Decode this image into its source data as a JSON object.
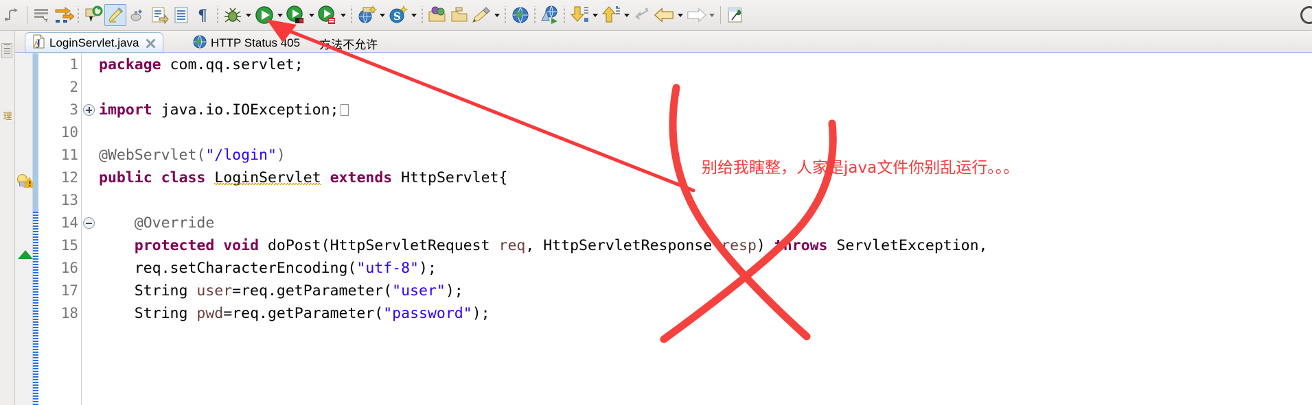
{
  "toolbar": {
    "items": [
      {
        "name": "skip-all-breakpoints-icon",
        "label": "Skip All Breakpoints"
      },
      {
        "name": "separator",
        "label": ""
      },
      {
        "name": "open-task-icon",
        "label": "Open Task"
      },
      {
        "name": "next-annotation-icon",
        "label": "Next Annotation"
      },
      {
        "name": "dots",
        "label": ""
      },
      {
        "name": "refresh-icon",
        "label": "Refresh"
      },
      {
        "name": "highlight-marker-icon",
        "label": "Toggle Mark Occurrences"
      },
      {
        "name": "build-icon",
        "label": "Build"
      },
      {
        "name": "new-java-file-icon",
        "label": "New Java File"
      },
      {
        "name": "open-type-icon",
        "label": "Open Type"
      },
      {
        "name": "pilcrow-icon",
        "label": "Show Whitespace Characters"
      },
      {
        "name": "dots",
        "label": ""
      },
      {
        "name": "debug-icon",
        "label": "Debug"
      },
      {
        "name": "debug-dropdown-arrow",
        "label": ""
      },
      {
        "name": "run-icon",
        "label": "Run"
      },
      {
        "name": "run-dropdown-arrow",
        "label": ""
      },
      {
        "name": "run-external-tools-icon",
        "label": "External Tools"
      },
      {
        "name": "external-tools-dropdown-arrow",
        "label": ""
      },
      {
        "name": "run-server-icon",
        "label": "Run On Server"
      },
      {
        "name": "server-dropdown-arrow",
        "label": ""
      },
      {
        "name": "dots",
        "label": ""
      },
      {
        "name": "new-web-project-icon",
        "label": "New Web Project"
      },
      {
        "name": "web-project-dropdown-arrow",
        "label": ""
      },
      {
        "name": "new-spring-icon",
        "label": "New Spring Element"
      },
      {
        "name": "spring-dropdown-arrow",
        "label": ""
      },
      {
        "name": "dots",
        "label": ""
      },
      {
        "name": "open-perspective-icon",
        "label": "Open Perspective"
      },
      {
        "name": "open-folder-icon",
        "label": "Open Folder"
      },
      {
        "name": "edit-pencil-icon",
        "label": "Edit"
      },
      {
        "name": "edit-dropdown-arrow",
        "label": ""
      },
      {
        "name": "dots",
        "label": ""
      },
      {
        "name": "open-web-browser-icon",
        "label": "Open Web Browser"
      },
      {
        "name": "dots",
        "label": ""
      },
      {
        "name": "publish-icon",
        "label": "Publish"
      },
      {
        "name": "dots",
        "label": ""
      },
      {
        "name": "import-icon",
        "label": "Import"
      },
      {
        "name": "import-dropdown-arrow",
        "label": ""
      },
      {
        "name": "export-icon",
        "label": "Export"
      },
      {
        "name": "export-dropdown-arrow",
        "label": ""
      },
      {
        "name": "undo-last-icon",
        "label": "Last Edit Location"
      },
      {
        "name": "back-icon",
        "label": "Back"
      },
      {
        "name": "back-dropdown-arrow",
        "label": ""
      },
      {
        "name": "forward-icon",
        "label": "Forward"
      },
      {
        "name": "forward-dropdown-arrow",
        "label": ""
      },
      {
        "name": "separator",
        "label": ""
      },
      {
        "name": "pin-editor-icon",
        "label": "Pin Editor"
      }
    ]
  },
  "editor": {
    "tabs": [
      {
        "name": "tab-loginservlet-java",
        "label": "LoginServlet.java",
        "icon": "java-file-icon",
        "selected": true,
        "closable": true,
        "sub": ""
      },
      {
        "name": "tab-http-status-405",
        "label": "HTTP Status 405",
        "icon": "web-browser-icon",
        "selected": false,
        "closable": false,
        "sub": "方法不允许"
      }
    ]
  },
  "code": {
    "lines": [
      {
        "num": "1",
        "marker": "",
        "fold": "",
        "change": "none"
      },
      {
        "num": "2",
        "marker": "",
        "fold": "",
        "change": "none"
      },
      {
        "num": "3",
        "marker": "",
        "fold": "plus",
        "change": "none"
      },
      {
        "num": "10",
        "marker": "",
        "fold": "",
        "change": "none"
      },
      {
        "num": "11",
        "marker": "",
        "fold": "",
        "change": "none"
      },
      {
        "num": "12",
        "marker": "bulb-warning",
        "fold": "",
        "change": "none"
      },
      {
        "num": "13",
        "marker": "",
        "fold": "",
        "change": "none"
      },
      {
        "num": "14",
        "marker": "",
        "fold": "minus",
        "change": "hatch"
      },
      {
        "num": "15",
        "marker": "green-triangle",
        "fold": "",
        "change": "hatch"
      },
      {
        "num": "16",
        "marker": "",
        "fold": "",
        "change": "hatch"
      },
      {
        "num": "17",
        "marker": "",
        "fold": "",
        "change": "hatch"
      },
      {
        "num": "18",
        "marker": "",
        "fold": "",
        "change": "hatch"
      }
    ],
    "text": {
      "l1_kw": "package",
      "l1_rest": " com.qq.servlet;",
      "l3_kw": "import",
      "l3_rest": " java.io.IOException;",
      "l11_ann": "@WebServlet(",
      "l11_str": "\"/login\"",
      "l11_end": ")",
      "l12_kw1": "public",
      "l12_kw2": "class",
      "l12_name": "LoginServlet",
      "l12_kw3": "extends",
      "l12_super": " HttpServlet{",
      "l14_ann": "@Override",
      "l15_kw1": "protected",
      "l15_kw2": "void",
      "l15_sig1": " doPost(HttpServletRequest ",
      "l15_p1": "req",
      "l15_sig2": ", HttpServletResponse ",
      "l15_p2": "resp",
      "l15_sig3": ") ",
      "l15_kw3": "throws",
      "l15_sig4": " ServletException,",
      "l16_a": "    req.setCharacterEncoding(",
      "l16_str": "\"utf-8\"",
      "l16_b": ");",
      "l17_a": "    String ",
      "l17_var": "user",
      "l17_b": "=req.getParameter(",
      "l17_str": "\"user\"",
      "l17_c": ");",
      "l18_a": "    String ",
      "l18_var": "pwd",
      "l18_b": "=req.getParameter(",
      "l18_str": "\"password\"",
      "l18_c": ");"
    }
  },
  "annotations": {
    "note_text": "别给我瞎整，人家是java文件你别乱运行。。。",
    "note_color": "#f8393c",
    "marks": [
      "arrow-to-run-button",
      "red-cross-over-code"
    ]
  },
  "colors": {
    "keyword": "#7f0055",
    "string": "#2a00ff",
    "annotation": "#646464",
    "parameter": "#6a3e3e",
    "accent_red": "#f8393c",
    "tab_selected_bg": "#dbe9f7"
  }
}
